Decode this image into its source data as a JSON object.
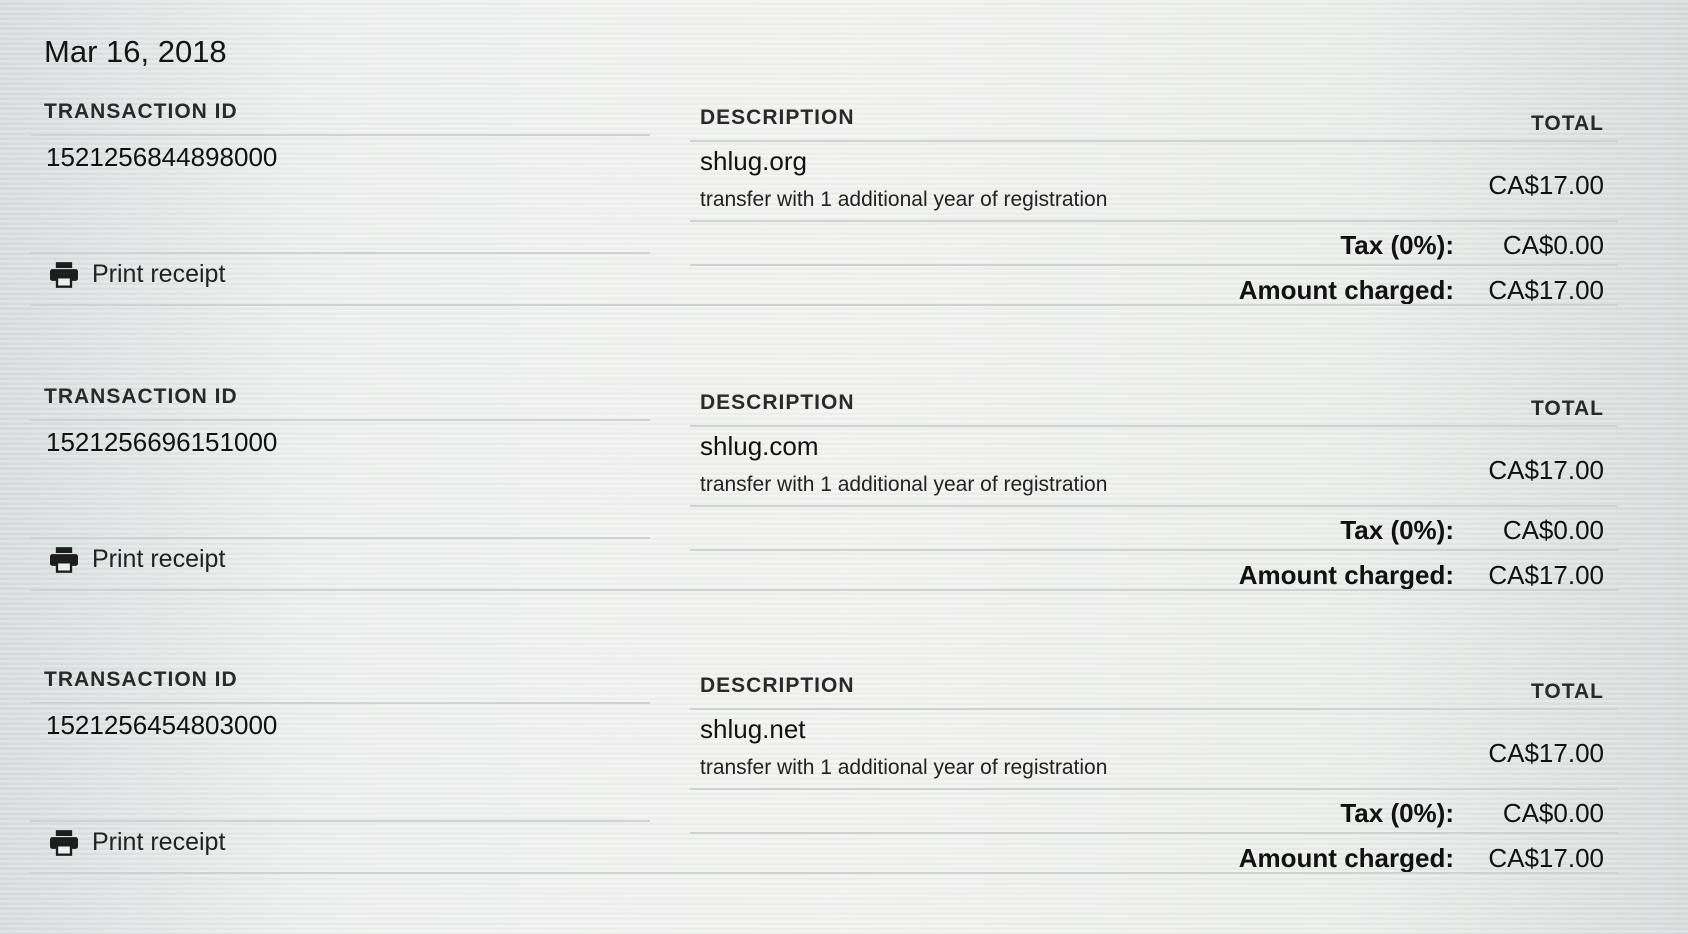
{
  "date": "Mar 16, 2018",
  "labels": {
    "transaction_id": "TRANSACTION ID",
    "description": "DESCRIPTION",
    "total": "TOTAL",
    "tax": "Tax (0%):",
    "amount_charged": "Amount charged:",
    "print_receipt": "Print receipt"
  },
  "icons": {
    "print": "printer-icon"
  },
  "colors": {
    "text": "#111111",
    "divider": "#cfd2d2",
    "background": "#eef0ef"
  },
  "transactions": [
    {
      "id": "1521256844898000",
      "domain": "shlug.org",
      "description": "transfer with 1 additional year of registration",
      "total": "CA$17.00",
      "tax": "CA$0.00",
      "amount_charged": "CA$17.00"
    },
    {
      "id": "1521256696151000",
      "domain": "shlug.com",
      "description": "transfer with 1 additional year of registration",
      "total": "CA$17.00",
      "tax": "CA$0.00",
      "amount_charged": "CA$17.00"
    },
    {
      "id": "1521256454803000",
      "domain": "shlug.net",
      "description": "transfer with 1 additional year of registration",
      "total": "CA$17.00",
      "tax": "CA$0.00",
      "amount_charged": "CA$17.00"
    }
  ]
}
